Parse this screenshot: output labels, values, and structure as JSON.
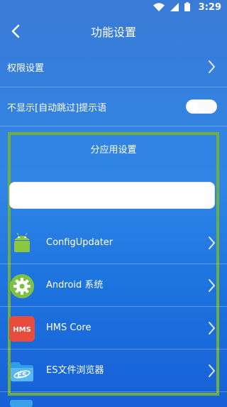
{
  "status_bar": {
    "time": "3:29",
    "icons": [
      "wifi-icon",
      "signal-icon",
      "battery-icon"
    ]
  },
  "header": {
    "title": "功能设置",
    "back_icon": "back-arrow-icon"
  },
  "settings": {
    "permission_label": "权限设置",
    "skip_tip_label": "不显示[自动跳过]提示语",
    "skip_tip_enabled": false
  },
  "per_app": {
    "section_title": "分应用设置",
    "search_placeholder": "",
    "apps": [
      {
        "name": "ConfigUpdater",
        "icon": "android-robot-icon"
      },
      {
        "name": "Android 系统",
        "icon": "android-system-gear-icon"
      },
      {
        "name": "HMS Core",
        "icon": "hms-core-icon"
      },
      {
        "name": "ES文件浏览器",
        "icon": "es-file-explorer-icon"
      }
    ]
  },
  "colors": {
    "background_top": "#3a7bd6",
    "background_bottom": "#1760d7",
    "highlight_border": "#6dad44"
  }
}
